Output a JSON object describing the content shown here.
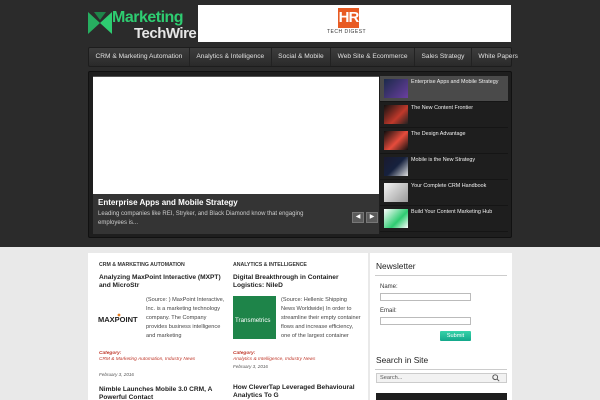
{
  "logo": {
    "line1": "Marketing",
    "line2": "TechWire"
  },
  "banner": {
    "mark": "HR",
    "sub": "TECH DIGEST"
  },
  "nav": [
    "CRM & Marketing Automation",
    "Analytics & Intelligence",
    "Social & Mobile",
    "Web Site & Ecommerce",
    "Sales Strategy",
    "White Papers"
  ],
  "slider": {
    "title": "Enterprise Apps and Mobile Strategy",
    "desc": "Leading companies like REI, Stryker, and Black Diamond know that engaging employees is...",
    "prev": "◀",
    "next": "▶",
    "thumbs": [
      "Enterprise Apps and Mobile Strategy",
      "The New Content Frontier",
      "The Design Advantage",
      "Mobile is the New Strategy",
      "Your Complete CRM Handbook",
      "Build Your Content Marketing Hub"
    ]
  },
  "left_col": {
    "category": "CRM & MARKETING AUTOMATION",
    "post1": {
      "title": "Analyzing MaxPoint Interactive (MXPT) and MicroStr",
      "logo": "MAXPOINT",
      "text": "(Source: ) MaxPoint Interactive, Inc. is a marketing technology company. The Company provides business intelligence and marketing",
      "cat_label": "Category:",
      "cats": "CRM & Marketing Automation, Industry News",
      "date": "February 3, 2016"
    },
    "post2": {
      "title": "Nimble Launches Mobile 3.0 CRM, A Powerful Contact"
    }
  },
  "mid_col": {
    "category": "ANALYTICS & INTELLIGENCE",
    "post1": {
      "title": "Digital Breakthrough in Container Logistics: NileD",
      "logo": "Transmetrics",
      "text": "(Source: Hellenic Shipping News Worldwide) In order to streamline their empty container flows and increase efficiency, one of the largest container",
      "cat_label": "Category:",
      "cats": "Analytics & Intelligence, Industry News",
      "date": "February 3, 2016"
    },
    "post2": {
      "title": "How CleverTap Leveraged Behavioural Analytics To G"
    }
  },
  "sidebar": {
    "newsletter": "Newsletter",
    "name_label": "Name:",
    "email_label": "Email:",
    "submit": "Submit",
    "search_head": "Search in Site",
    "search_placeholder": "Search..."
  },
  "colors": {
    "accent": "#2ecc71",
    "category": "#c0392b",
    "submit": "#13a88a"
  }
}
